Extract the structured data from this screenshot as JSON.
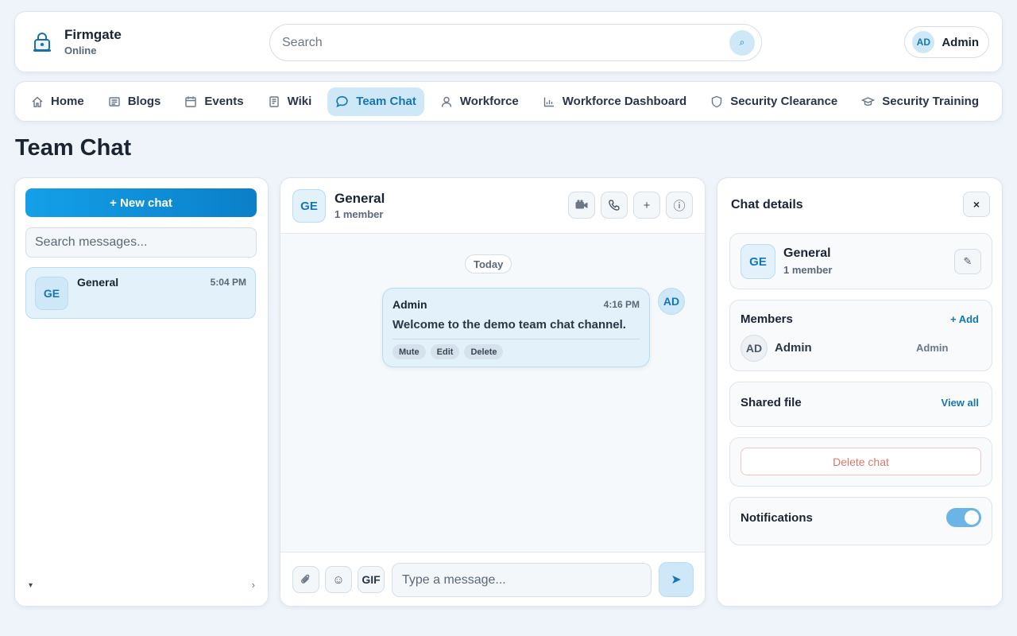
{
  "brand": {
    "name": "Firmgate",
    "status": "Online"
  },
  "search": {
    "placeholder": "Search",
    "button_glyph": "⌕"
  },
  "user": {
    "initials": "AD",
    "name": "Admin"
  },
  "nav": [
    {
      "label": "Home",
      "icon": "home-icon"
    },
    {
      "label": "Blogs",
      "icon": "blog-icon"
    },
    {
      "label": "Events",
      "icon": "calendar-icon"
    },
    {
      "label": "Wiki",
      "icon": "book-icon"
    },
    {
      "label": "Team Chat",
      "icon": "chat-icon",
      "active": true
    },
    {
      "label": "Workforce",
      "icon": "person-icon"
    },
    {
      "label": "Workforce Dashboard",
      "icon": "chart-icon"
    },
    {
      "label": "Security Clearance",
      "icon": "shield-icon"
    },
    {
      "label": "Security Training",
      "icon": "graduation-cap-icon"
    }
  ],
  "page": {
    "title": "Team Chat"
  },
  "sidebar": {
    "new_chat_label": "+ New chat",
    "search_placeholder": "Search messages...",
    "conversations": [
      {
        "initials": "GE",
        "name": "General",
        "time": "5:04 PM"
      }
    ],
    "collapse_glyph": "▾",
    "next_glyph": "›"
  },
  "channel": {
    "initials": "GE",
    "name": "General",
    "members": "1 member",
    "day_label": "Today",
    "messages": [
      {
        "author": "Admin",
        "initials": "AD",
        "time": "4:16 PM",
        "text": "Welcome to the demo team chat channel.",
        "actions": [
          "Mute",
          "Edit",
          "Delete"
        ]
      }
    ],
    "composer": {
      "placeholder": "Type a message...",
      "gif_label": "GIF",
      "emoji_glyph": "☺",
      "send_glyph": "➤"
    },
    "header_glyphs": {
      "add": "+",
      "info": "ⓘ"
    }
  },
  "details": {
    "title": "Chat details",
    "close_glyph": "×",
    "group": {
      "initials": "GE",
      "name": "General",
      "members": "1 member",
      "edit_glyph": "✎"
    },
    "members_section": {
      "label": "Members",
      "add_label": "+ Add",
      "list": [
        {
          "initials": "AD",
          "name": "Admin",
          "role": "Admin"
        }
      ]
    },
    "shared_file": {
      "label": "Shared file",
      "link": "View all"
    },
    "delete_label": "Delete chat",
    "notifications": {
      "label": "Notifications",
      "enabled": true
    }
  },
  "colors": {
    "accent": "#1576b4",
    "accent_soft": "#cfe8f7",
    "background": "#eef4f9",
    "danger": "#d9776f"
  }
}
